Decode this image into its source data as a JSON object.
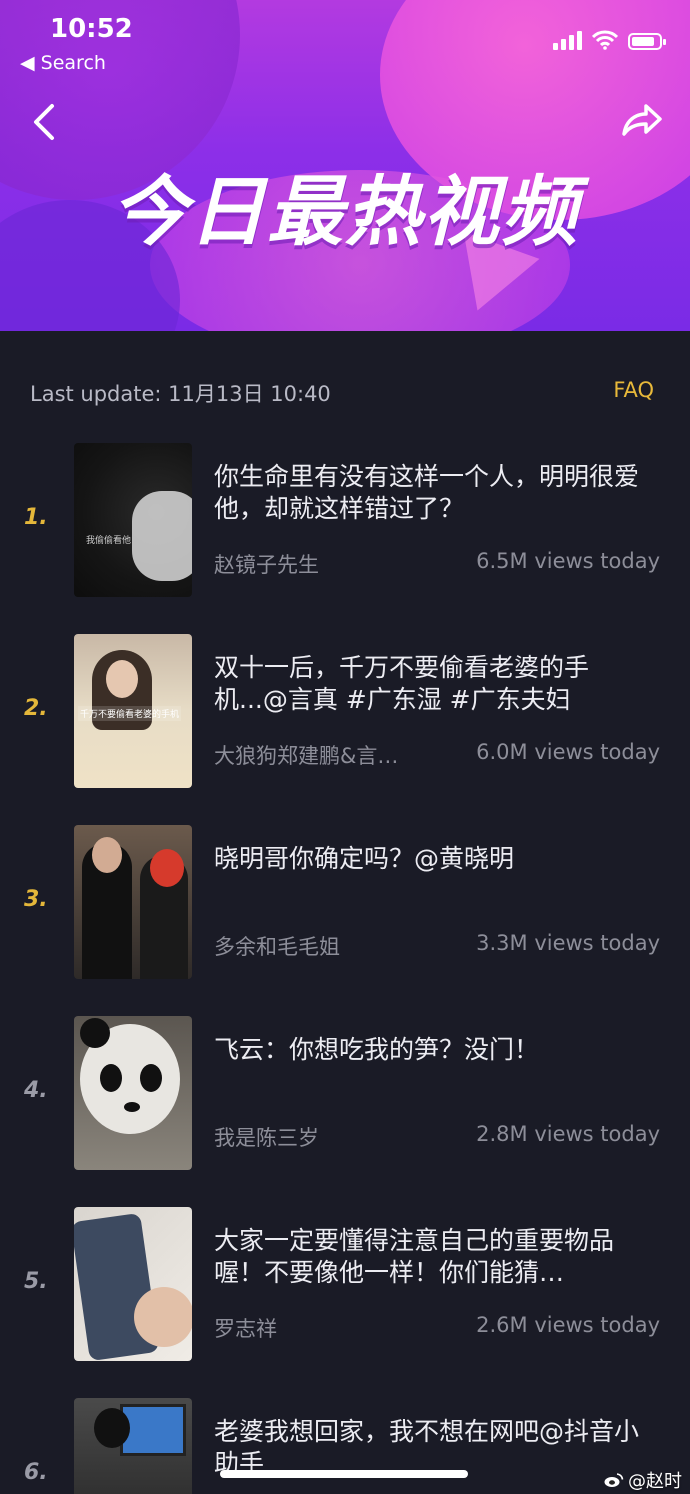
{
  "status_bar": {
    "time": "10:52",
    "back_label": "◀ Search"
  },
  "header": {
    "title": "今日最热视频",
    "back_icon": "chevron-left-icon",
    "share_icon": "share-arrow-icon"
  },
  "update": {
    "label": "Last update: 11月13日 10:40",
    "faq": "FAQ"
  },
  "items": [
    {
      "rank": "1.",
      "title": "你生命里有没有这样一个人，明明很爱他，却就这样错过了？",
      "author": "赵镜子先生",
      "views": "6.5M views today",
      "thumb_caption": "我偷偷看他"
    },
    {
      "rank": "2.",
      "title": "双十一后，千万不要偷看老婆的手机...@言真 #广东湿 #广东夫妇",
      "author": "大狼狗郑建鹏&言…",
      "views": "6.0M views today",
      "thumb_caption": "千万不要偷看老婆的手机"
    },
    {
      "rank": "3.",
      "title": "晓明哥你确定吗？@黄晓明",
      "author": "多余和毛毛姐",
      "views": "3.3M views today"
    },
    {
      "rank": "4.",
      "title": "飞云：你想吃我的笋？没门！",
      "author": "我是陈三岁",
      "views": "2.8M views today"
    },
    {
      "rank": "5.",
      "title": "大家一定要懂得注意自己的重要物品喔！不要像他一样！你们能猜…",
      "author": "罗志祥",
      "views": "2.6M views today"
    },
    {
      "rank": "6.",
      "title": "老婆我想回家，我不想在网吧@抖音小助手",
      "author": "",
      "views": ""
    }
  ],
  "colors": {
    "rank_top": "#e4b73a",
    "rank_other": "#9a9ba6",
    "faq": "#e8b93a",
    "background": "#1a1b26"
  },
  "watermark": "@赵时"
}
